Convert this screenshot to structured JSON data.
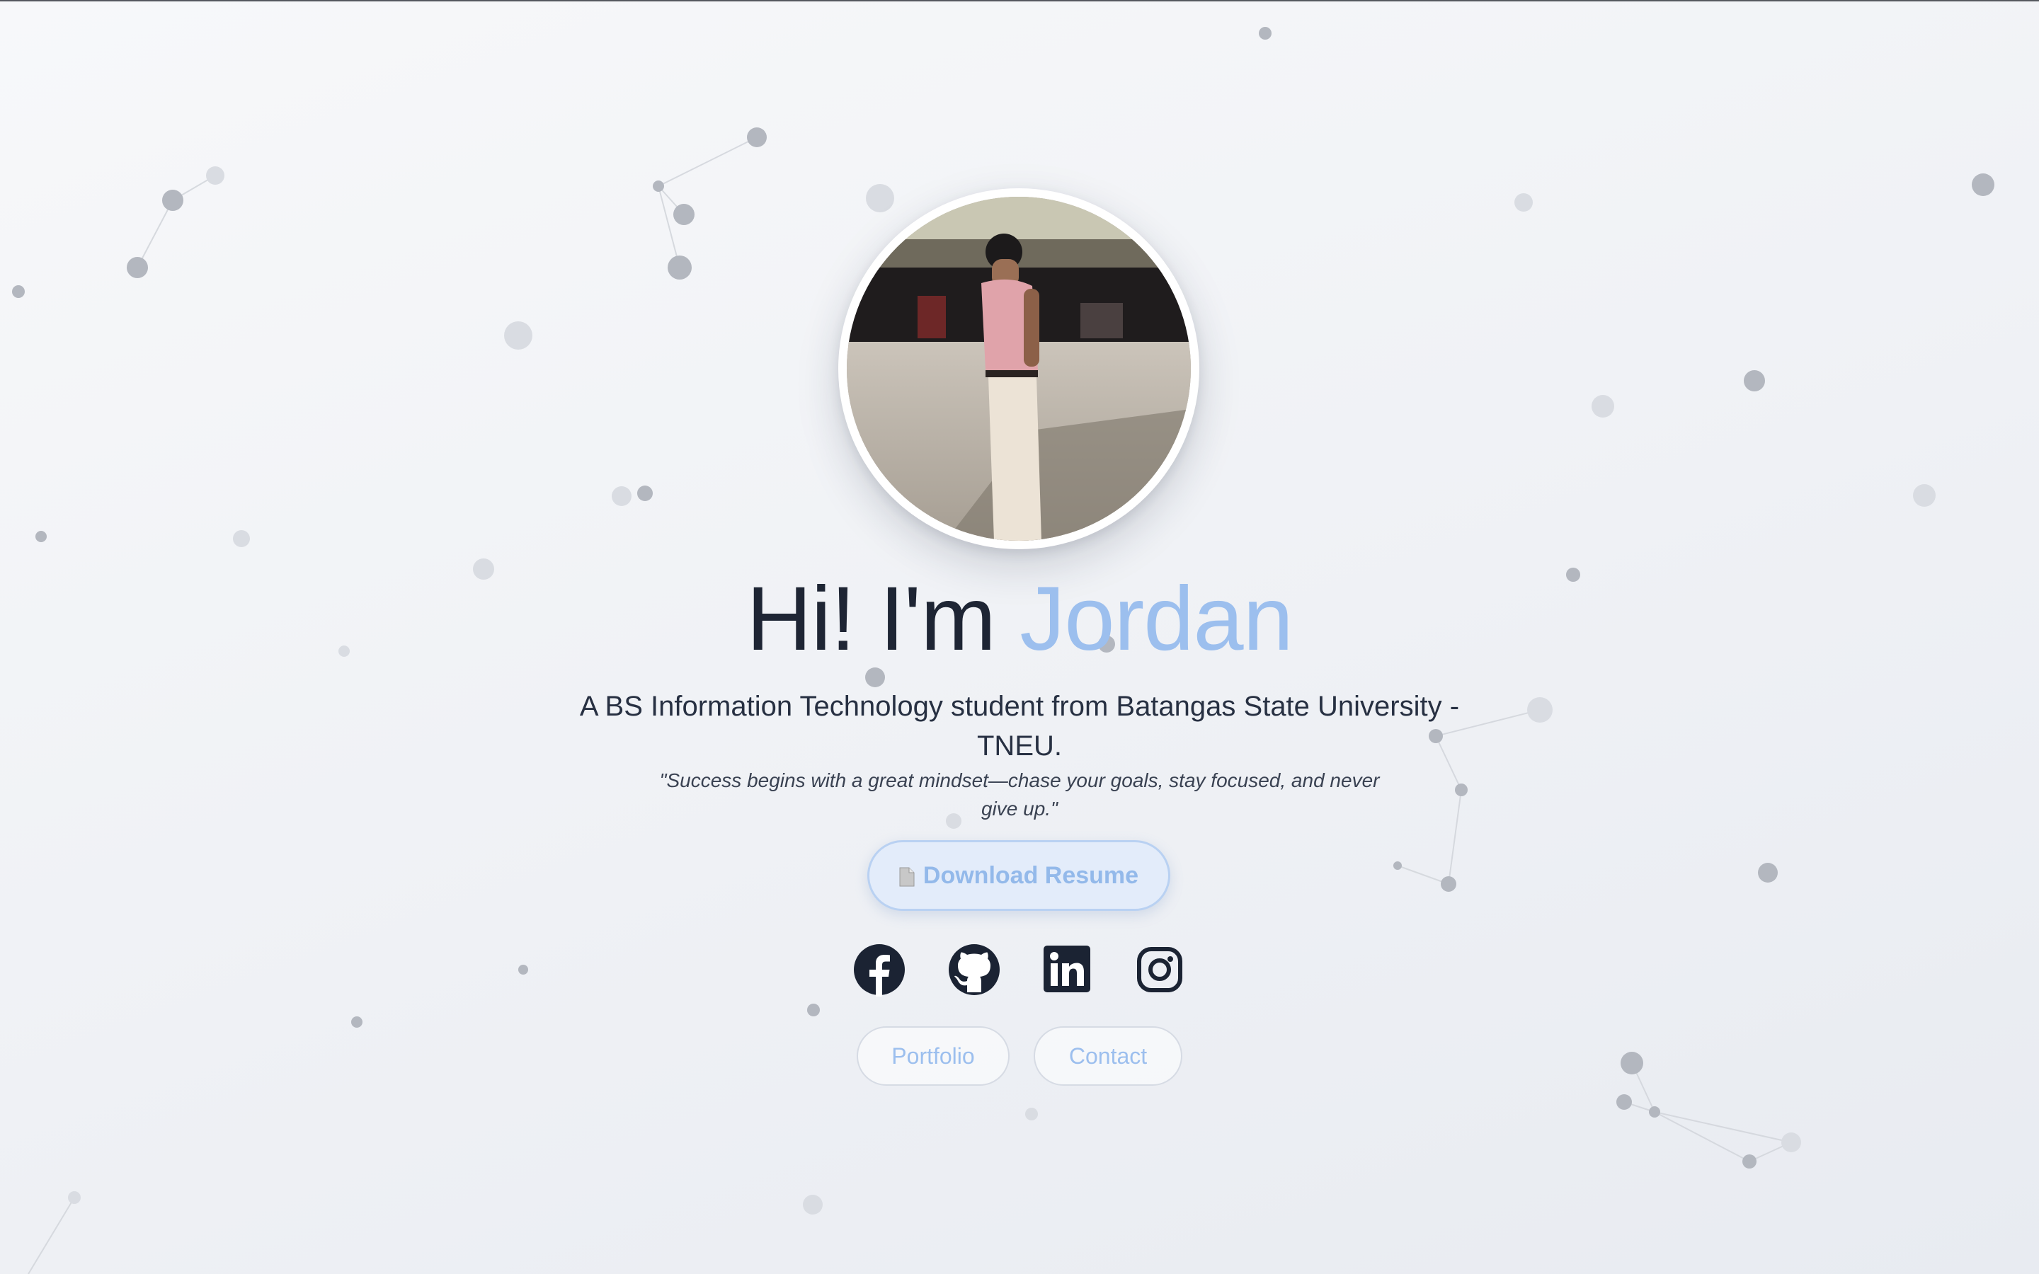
{
  "hero": {
    "greeting": "Hi! I'm ",
    "name": "Jordan",
    "subtitle": "A BS Information Technology student from Batangas State University - TNEU.",
    "quote": "\"Success begins with a great mindset—chase your goals, stay focused, and never give up.\"",
    "resume_button": "Download Resume"
  },
  "socials": [
    {
      "icon": "facebook-icon"
    },
    {
      "icon": "github-icon"
    },
    {
      "icon": "linkedin-icon"
    },
    {
      "icon": "instagram-icon"
    }
  ],
  "nav": {
    "portfolio": "Portfolio",
    "contact": "Contact"
  },
  "colors": {
    "accent": "#9cbfee",
    "text": "#1e2534",
    "background": "#f3f5f8"
  }
}
